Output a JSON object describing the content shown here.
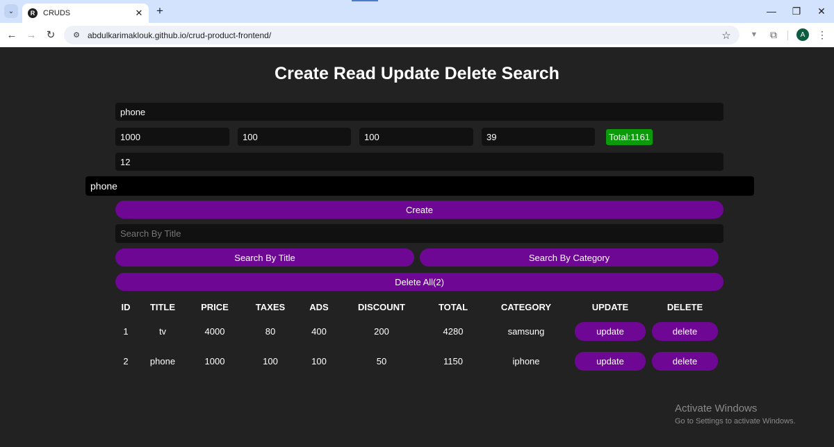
{
  "browser": {
    "tab_title": "CRUDS",
    "tab_favicon": "R",
    "url": "abdulkarimaklouk.github.io/crud-product-frontend/",
    "profile_initial": "A",
    "icons": {
      "tab_search": "⌄",
      "close_tab": "✕",
      "new_tab": "+",
      "back": "←",
      "forward": "→",
      "reload": "↻",
      "site_info": "⚙",
      "bookmark": "☆",
      "extension_v": "▼",
      "extensions": "⧉",
      "menu": "⋮",
      "minimize": "—",
      "maximize": "❐",
      "close": "✕"
    }
  },
  "page": {
    "title": "Create Read Update Delete Search",
    "form": {
      "title_value": "phone",
      "price_value": "1000",
      "taxes_value": "100",
      "ads_value": "100",
      "discount_value": "39",
      "total_label": "Total:1161",
      "count_value": "12",
      "category_value": "phone",
      "create_label": "Create"
    },
    "search": {
      "placeholder": "Search By Title",
      "value": "",
      "by_title_label": "Search By Title",
      "by_category_label": "Search By Category"
    },
    "delete_all_label": "Delete All(2)",
    "table": {
      "headers": [
        "ID",
        "TITLE",
        "PRICE",
        "TAXES",
        "ADS",
        "DISCOUNT",
        "TOTAL",
        "CATEGORY",
        "UPDATE",
        "DELETE"
      ],
      "rows": [
        {
          "id": "1",
          "title": "tv",
          "price": "4000",
          "taxes": "80",
          "ads": "400",
          "discount": "200",
          "total": "4280",
          "category": "samsung",
          "update": "update",
          "delete": "delete"
        },
        {
          "id": "2",
          "title": "phone",
          "price": "1000",
          "taxes": "100",
          "ads": "100",
          "discount": "50",
          "total": "1150",
          "category": "iphone",
          "update": "update",
          "delete": "delete"
        }
      ]
    }
  },
  "watermark": {
    "title": "Activate Windows",
    "subtitle": "Go to Settings to activate Windows."
  },
  "colors": {
    "background": "#222222",
    "input_bg": "#111111",
    "button_purple": "#6e0894",
    "total_green": "#0a9a0a"
  }
}
